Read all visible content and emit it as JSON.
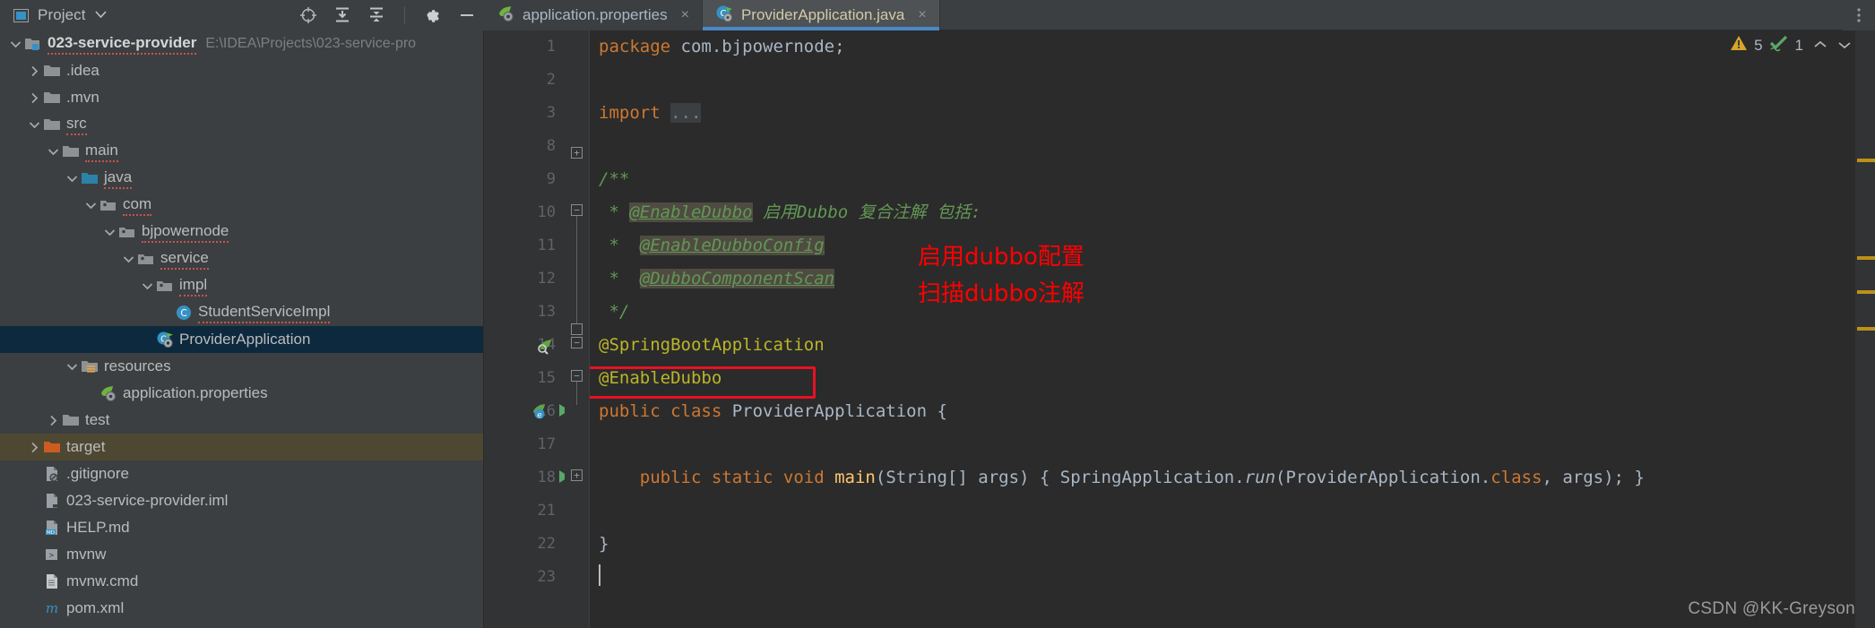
{
  "tool_window": {
    "title": "Project",
    "caret_icon": "chevron-down-icon",
    "window_icon": "project-view-icon",
    "actions": [
      {
        "name": "locate-icon",
        "label": "⊕"
      },
      {
        "name": "expand-all-icon",
        "label": "⨅"
      },
      {
        "name": "collapse-all-icon",
        "label": "⨄"
      },
      {
        "name": "gear-icon",
        "label": "⚙"
      },
      {
        "name": "hide-icon",
        "label": "—"
      }
    ]
  },
  "tree": [
    {
      "label": "023-service-provider",
      "hint": "E:\\IDEA\\Projects\\023-service-pro",
      "indent": 0,
      "arrow": "expanded",
      "icon": "module-folder-icon",
      "bold": true,
      "spellcheck": true,
      "state": "normal"
    },
    {
      "label": ".idea",
      "hint": "",
      "indent": 1,
      "arrow": "collapsed",
      "icon": "folder-icon",
      "bold": false,
      "spellcheck": false,
      "state": "normal"
    },
    {
      "label": ".mvn",
      "hint": "",
      "indent": 1,
      "arrow": "collapsed",
      "icon": "folder-icon",
      "bold": false,
      "spellcheck": false,
      "state": "normal"
    },
    {
      "label": "src",
      "hint": "",
      "indent": 1,
      "arrow": "expanded",
      "icon": "folder-icon",
      "bold": false,
      "spellcheck": true,
      "state": "normal"
    },
    {
      "label": "main",
      "hint": "",
      "indent": 2,
      "arrow": "expanded",
      "icon": "folder-icon",
      "bold": false,
      "spellcheck": true,
      "state": "normal"
    },
    {
      "label": "java",
      "hint": "",
      "indent": 3,
      "arrow": "expanded",
      "icon": "source-root-icon",
      "bold": false,
      "spellcheck": true,
      "state": "normal"
    },
    {
      "label": "com",
      "hint": "",
      "indent": 4,
      "arrow": "expanded",
      "icon": "package-icon",
      "bold": false,
      "spellcheck": true,
      "state": "normal"
    },
    {
      "label": "bjpowernode",
      "hint": "",
      "indent": 5,
      "arrow": "expanded",
      "icon": "package-icon",
      "bold": false,
      "spellcheck": true,
      "state": "normal"
    },
    {
      "label": "service",
      "hint": "",
      "indent": 6,
      "arrow": "expanded",
      "icon": "package-icon",
      "bold": false,
      "spellcheck": true,
      "state": "normal"
    },
    {
      "label": "impl",
      "hint": "",
      "indent": 7,
      "arrow": "expanded",
      "icon": "package-icon",
      "bold": false,
      "spellcheck": true,
      "state": "normal"
    },
    {
      "label": "StudentServiceImpl",
      "hint": "",
      "indent": 8,
      "arrow": "none",
      "icon": "java-class-icon",
      "bold": false,
      "spellcheck": true,
      "state": "normal"
    },
    {
      "label": "ProviderApplication",
      "hint": "",
      "indent": 7,
      "arrow": "none",
      "icon": "spring-boot-class-icon",
      "bold": false,
      "spellcheck": false,
      "state": "selected"
    },
    {
      "label": "resources",
      "hint": "",
      "indent": 3,
      "arrow": "expanded",
      "icon": "resources-folder-icon",
      "bold": false,
      "spellcheck": false,
      "state": "normal"
    },
    {
      "label": "application.properties",
      "hint": "",
      "indent": 4,
      "arrow": "none",
      "icon": "spring-properties-icon",
      "bold": false,
      "spellcheck": false,
      "state": "normal"
    },
    {
      "label": "test",
      "hint": "",
      "indent": 2,
      "arrow": "collapsed",
      "icon": "folder-icon",
      "bold": false,
      "spellcheck": false,
      "state": "normal"
    },
    {
      "label": "target",
      "hint": "",
      "indent": 1,
      "arrow": "collapsed",
      "icon": "target-folder-icon",
      "bold": false,
      "spellcheck": false,
      "state": "target"
    },
    {
      "label": ".gitignore",
      "hint": "",
      "indent": 1,
      "arrow": "none",
      "icon": "gitignore-file-icon",
      "bold": false,
      "spellcheck": false,
      "state": "normal"
    },
    {
      "label": "023-service-provider.iml",
      "hint": "",
      "indent": 1,
      "arrow": "none",
      "icon": "iml-file-icon",
      "bold": false,
      "spellcheck": false,
      "state": "normal"
    },
    {
      "label": "HELP.md",
      "hint": "",
      "indent": 1,
      "arrow": "none",
      "icon": "markdown-file-icon",
      "bold": false,
      "spellcheck": false,
      "state": "normal"
    },
    {
      "label": "mvnw",
      "hint": "",
      "indent": 1,
      "arrow": "none",
      "icon": "shell-script-icon",
      "bold": false,
      "spellcheck": false,
      "state": "normal"
    },
    {
      "label": "mvnw.cmd",
      "hint": "",
      "indent": 1,
      "arrow": "none",
      "icon": "cmd-file-icon",
      "bold": false,
      "spellcheck": false,
      "state": "normal"
    },
    {
      "label": "pom.xml",
      "hint": "",
      "indent": 1,
      "arrow": "none",
      "icon": "maven-pom-icon",
      "bold": false,
      "spellcheck": false,
      "state": "normal"
    }
  ],
  "tabs": [
    {
      "label": "application.properties",
      "icon": "spring-properties-icon",
      "active": false,
      "close": "×"
    },
    {
      "label": "ProviderApplication.java",
      "icon": "spring-boot-class-icon",
      "active": true,
      "close": "×"
    }
  ],
  "editor": {
    "line_numbers": [
      "1",
      "2",
      "3",
      "8",
      "9",
      "10",
      "11",
      "12",
      "13",
      "14",
      "15",
      "16",
      "17",
      "18",
      "21",
      "22",
      "23"
    ],
    "lines": [
      {
        "no": "1",
        "segments": [
          {
            "t": "package ",
            "c": "kw"
          },
          {
            "t": "com.bjpowernode;",
            "c": "plain"
          }
        ]
      },
      {
        "no": "2",
        "segments": []
      },
      {
        "no": "3",
        "segments": [
          {
            "t": "import ",
            "c": "kw"
          },
          {
            "t": "...",
            "c": "fold-placeholder"
          }
        ]
      },
      {
        "no": "8",
        "segments": []
      },
      {
        "no": "9",
        "segments": [
          {
            "t": "/**",
            "c": "cmt"
          }
        ]
      },
      {
        "no": "10",
        "segments": [
          {
            "t": " * ",
            "c": "cmt"
          },
          {
            "t": "@EnableDubbo",
            "c": "cmt-ref"
          },
          {
            "t": " 启用Dubbo 复合注解 包括:",
            "c": "cmt"
          }
        ]
      },
      {
        "no": "11",
        "segments": [
          {
            "t": " *  ",
            "c": "cmt"
          },
          {
            "t": "@EnableDubboConfig",
            "c": "cmt-ref"
          }
        ]
      },
      {
        "no": "12",
        "segments": [
          {
            "t": " *  ",
            "c": "cmt"
          },
          {
            "t": "@DubboComponentScan",
            "c": "cmt-ref"
          }
        ]
      },
      {
        "no": "13",
        "segments": [
          {
            "t": " */",
            "c": "cmt"
          }
        ]
      },
      {
        "no": "14",
        "segments": [
          {
            "t": "@SpringBootApplication",
            "c": "anno"
          }
        ]
      },
      {
        "no": "15",
        "segments": [
          {
            "t": "@EnableDubbo",
            "c": "anno"
          }
        ]
      },
      {
        "no": "16",
        "segments": [
          {
            "t": "public class ",
            "c": "kw"
          },
          {
            "t": "ProviderApplication {",
            "c": "plain"
          }
        ]
      },
      {
        "no": "17",
        "segments": []
      },
      {
        "no": "18",
        "segments": [
          {
            "t": "    public static void ",
            "c": "kw"
          },
          {
            "t": "main",
            "c": "mname"
          },
          {
            "t": "(String[] args) ",
            "c": "plain"
          },
          {
            "t": "{ SpringApplication.",
            "c": "plain"
          },
          {
            "t": "run",
            "c": "plain-italic"
          },
          {
            "t": "(ProviderApplication.",
            "c": "plain"
          },
          {
            "t": "class",
            "c": "kw"
          },
          {
            "t": ", args); }",
            "c": "plain"
          }
        ]
      },
      {
        "no": "21",
        "segments": []
      },
      {
        "no": "22",
        "segments": [
          {
            "t": "}",
            "c": "plain"
          }
        ]
      },
      {
        "no": "23",
        "segments": []
      }
    ],
    "annotations": [
      {
        "name": "enable-dubbo-highlight-box",
        "kind": "red-rect"
      },
      {
        "name": "red-note-1",
        "text": "启用dubbo配置"
      },
      {
        "name": "red-note-2",
        "text": "扫描dubbo注解"
      }
    ],
    "inspection_widget": {
      "warning_icon": "warning-triangle-icon",
      "warning_count": "5",
      "ok_icon": "inspection-ok-icon",
      "ok_count": "1",
      "prev_icon": "chevron-up-icon",
      "next_icon": "chevron-down-icon"
    },
    "markers": [
      14,
      38,
      44,
      49
    ]
  },
  "watermark": "CSDN @KK-Greyson",
  "colors": {
    "editor_bg": "#2b2b2b",
    "panel_bg": "#3c3f41",
    "gutter_bg": "#313335",
    "selection_blue": "#0d293e",
    "tab_active_underline": "#4a88c7",
    "annotation_yellow": "#bbb529",
    "keyword_orange": "#cc7832",
    "comment_green": "#629755",
    "method_yellow": "#ffc66d",
    "red_highlight": "#e81123",
    "target_row": "#4e4833",
    "marker_yellow": "#bc9117"
  }
}
